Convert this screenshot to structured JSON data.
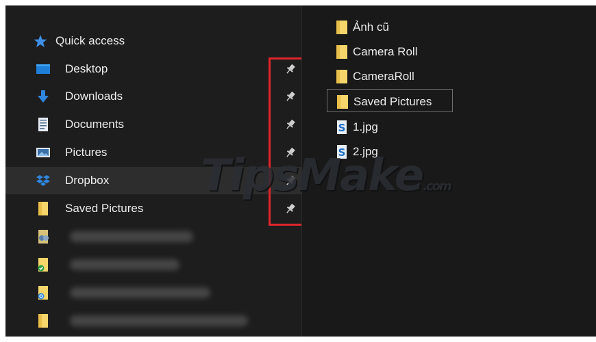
{
  "sidebar": {
    "quick_access": "Quick access",
    "items": [
      {
        "label": "Desktop",
        "icon": "desktop-icon"
      },
      {
        "label": "Downloads",
        "icon": "download-arrow-icon"
      },
      {
        "label": "Documents",
        "icon": "documents-icon"
      },
      {
        "label": "Pictures",
        "icon": "pictures-icon"
      },
      {
        "label": "Dropbox",
        "icon": "dropbox-icon"
      },
      {
        "label": "Saved Pictures",
        "icon": "folder-icon"
      }
    ],
    "blurred_items": [
      {
        "icon": "network-folder-icon"
      },
      {
        "icon": "synced-folder-icon"
      },
      {
        "icon": "sync-folder-icon"
      },
      {
        "icon": "folder-icon"
      }
    ]
  },
  "content": {
    "items": [
      {
        "label": "Ảnh cũ",
        "type": "folder"
      },
      {
        "label": "Camera Roll",
        "type": "folder"
      },
      {
        "label": "CameraRoll",
        "type": "folder"
      },
      {
        "label": "Saved Pictures",
        "type": "folder",
        "selected": true
      },
      {
        "label": "1.jpg",
        "type": "file"
      },
      {
        "label": "2.jpg",
        "type": "file"
      }
    ]
  },
  "watermark": {
    "text": "TipsMake",
    "suffix": ".com"
  },
  "colors": {
    "highlight": "#e1252c",
    "folder": "#f6d56b",
    "background": "#191919"
  }
}
